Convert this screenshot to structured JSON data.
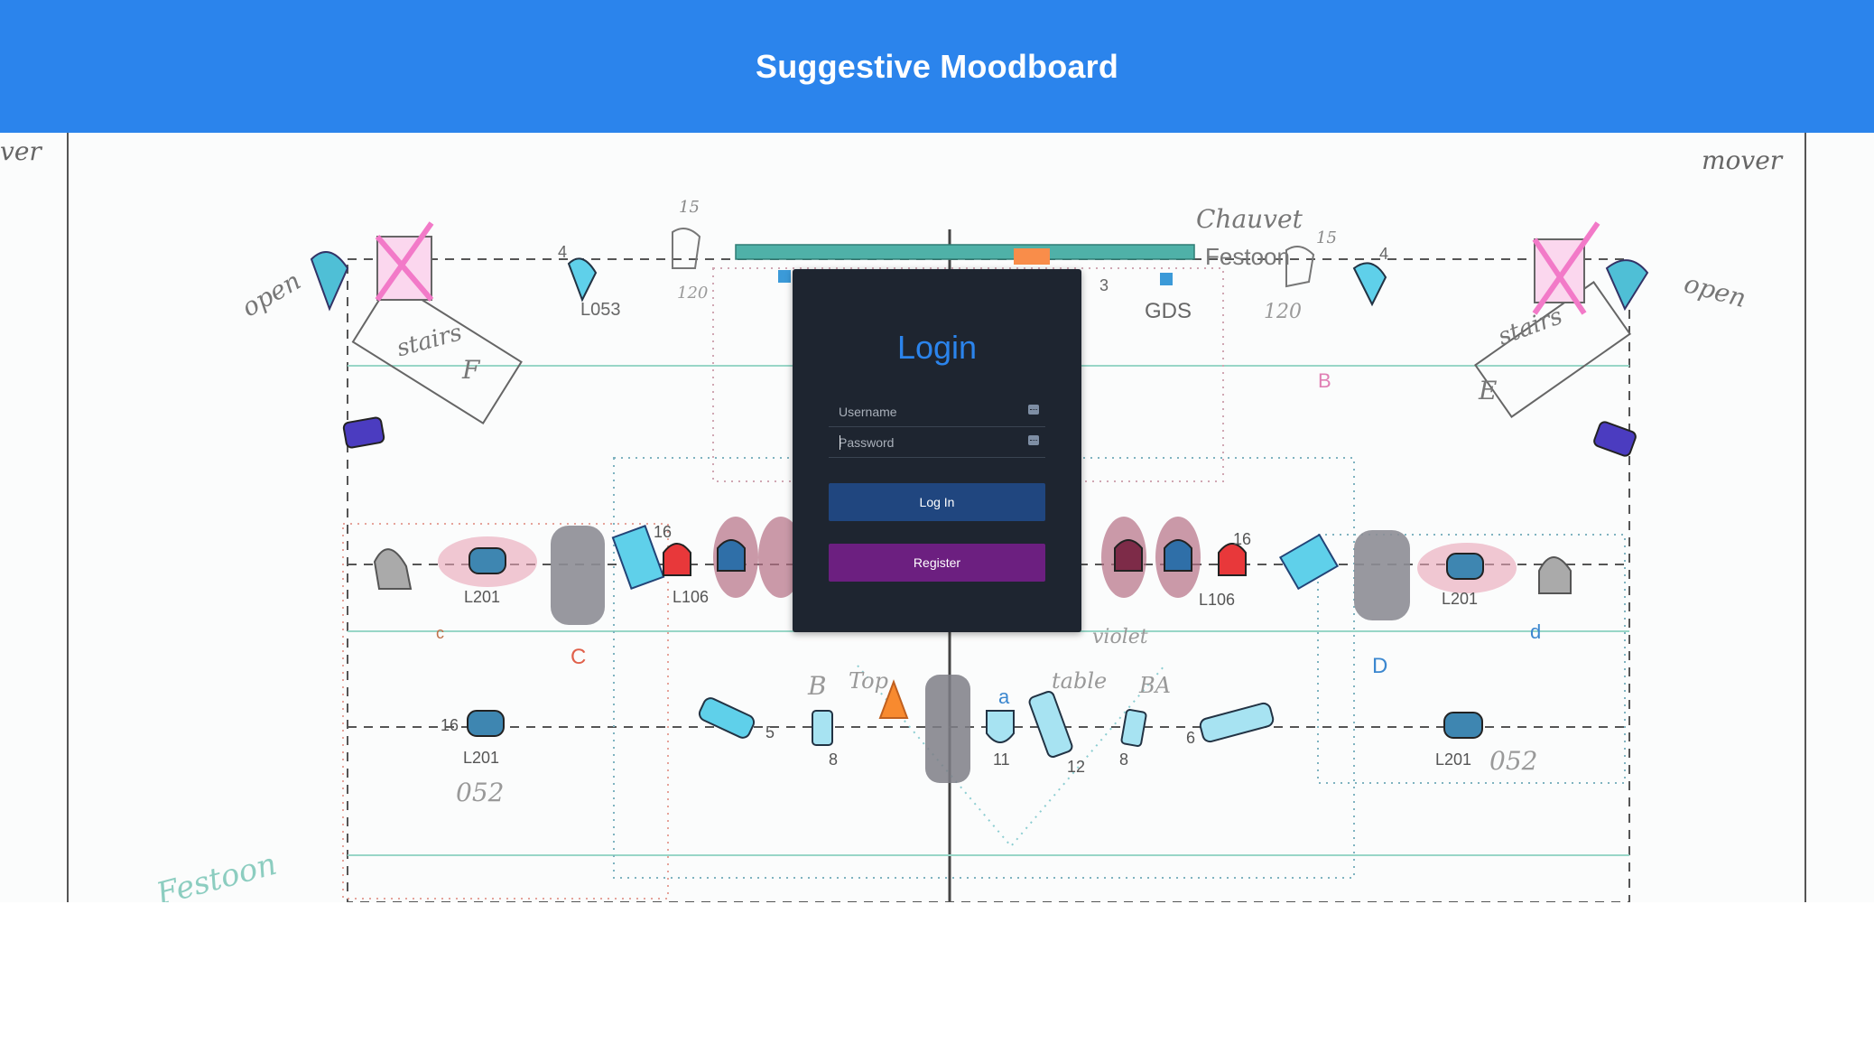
{
  "header": {
    "title": "Suggestive Moodboard"
  },
  "background": {
    "labels": {
      "mover_left": "ver",
      "mover_right": "mover",
      "open_left": "open",
      "open_right": "open",
      "stairs_left": "stairs",
      "stairs_right": "stairs",
      "f_left": "F",
      "e_right": "E",
      "chauvet": "Chauvet",
      "festoon_top": "Festoon",
      "festoon_bottom": "Festoon",
      "l053": "L053",
      "gds": "GDS",
      "n120a": "120",
      "n120b": "120",
      "n15a": "15",
      "n15b": "15",
      "n4a": "4",
      "n4b": "4",
      "n3": "3",
      "b_pink": "B",
      "c_small": "c",
      "c_big": "C",
      "d_big": "D",
      "d_small": "d",
      "l201a": "L201",
      "l201b": "L201",
      "l201c": "L201",
      "l201d": "L201",
      "l106a": "L106",
      "l106b": "L106",
      "n16a": "16",
      "n16b": "16",
      "n16c": "16",
      "n5": "5",
      "n8a": "8",
      "n8b": "8",
      "n11": "11",
      "n12": "12",
      "n6": "6",
      "a_label": "a",
      "ba_label": "BA",
      "b_label": "B",
      "top_label": "Top",
      "table_label": "table",
      "n052a": "052",
      "n052b": "052",
      "violet": "violet"
    }
  },
  "login": {
    "title": "Login",
    "username": {
      "placeholder": "Username",
      "value": ""
    },
    "password": {
      "placeholder": "Password",
      "value": ""
    },
    "login_button": "Log In",
    "register_button": "Register"
  },
  "colors": {
    "header_bg": "#2b84ec",
    "card_bg": "#1e2530",
    "title_color": "#2b84ec",
    "login_button": "#20467f",
    "register_button": "#6c1f80"
  }
}
